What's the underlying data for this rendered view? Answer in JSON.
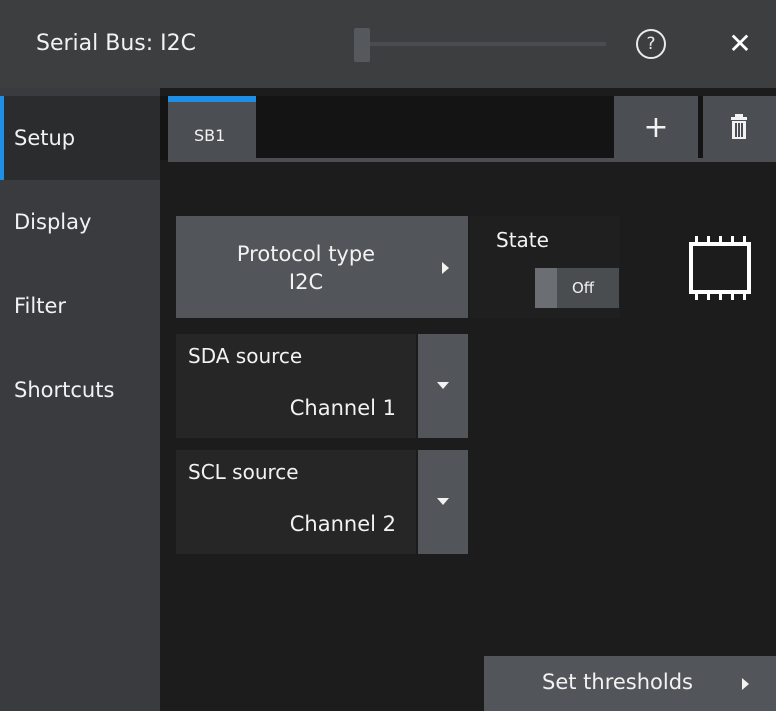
{
  "window": {
    "title": "Serial Bus: I2C",
    "help_icon": "question-circle-icon",
    "help_glyph": "?",
    "close_icon": "close-x-icon",
    "close_glyph": "✕"
  },
  "sidebar": {
    "items": [
      {
        "label": "Setup",
        "active": true
      },
      {
        "label": "Display",
        "active": false
      },
      {
        "label": "Filter",
        "active": false
      },
      {
        "label": "Shortcuts",
        "active": false
      }
    ]
  },
  "tabs": {
    "items": [
      {
        "label": "SB1",
        "active": true
      }
    ],
    "add_glyph": "+",
    "add_icon": "plus-icon",
    "delete_icon": "trash-icon"
  },
  "protocol": {
    "label": "Protocol type",
    "value": "I2C"
  },
  "state": {
    "label": "State",
    "value": "Off",
    "chip_icon": "chip-icon"
  },
  "sda": {
    "label": "SDA source",
    "value": "Channel 1"
  },
  "scl": {
    "label": "SCL source",
    "value": "Channel 2"
  },
  "thresholds": {
    "label": "Set thresholds"
  },
  "colors": {
    "accent": "#1f8fe6",
    "button": "#52565a",
    "sidebar": "#393b3e",
    "titlebar": "#3c3e40",
    "background": "#1c1c1c"
  }
}
